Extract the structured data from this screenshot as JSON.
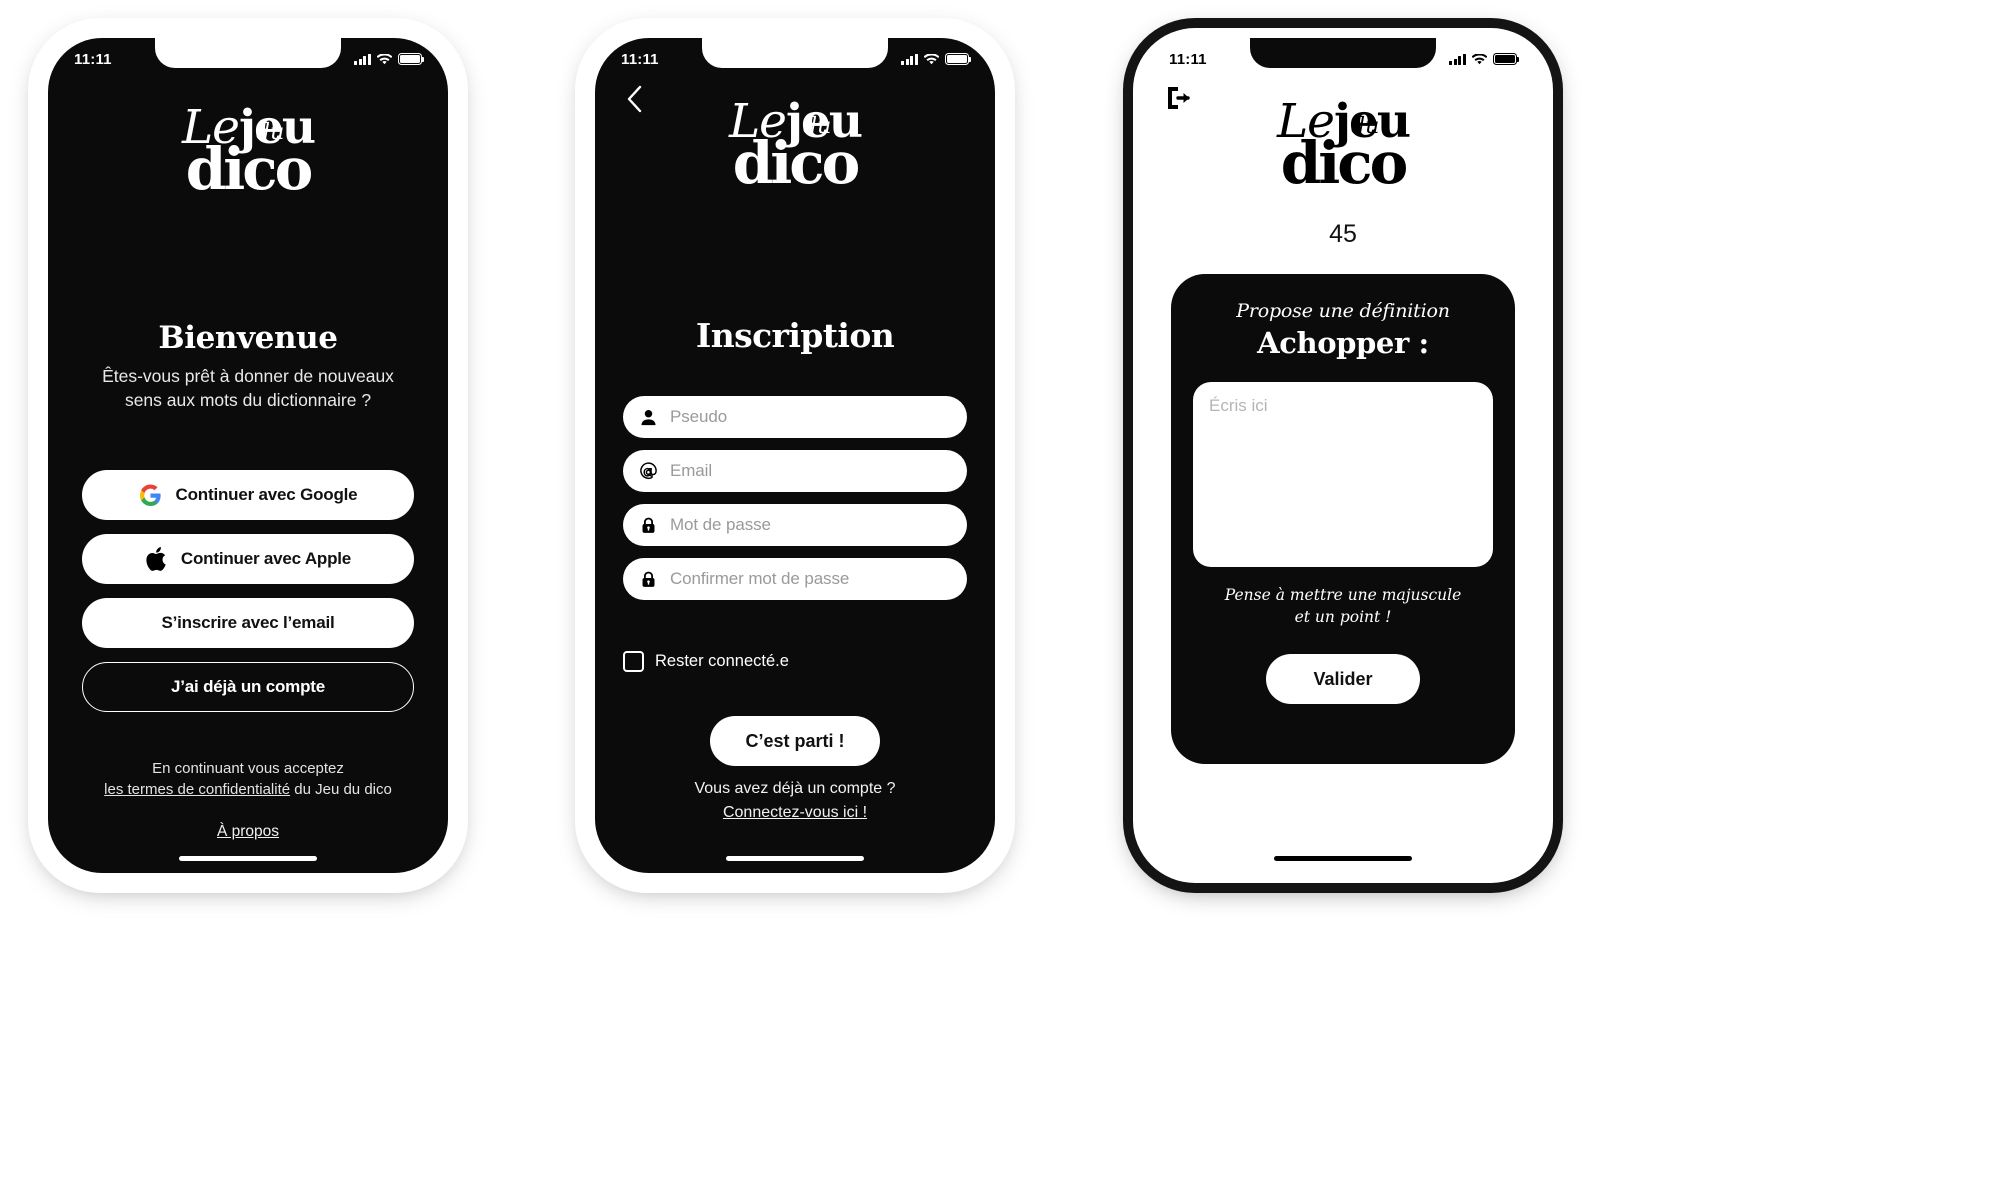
{
  "meta": {
    "accent_dark": "#0b0b0b",
    "accent_light": "#ffffff",
    "google_blue": "#4285F4",
    "google_red": "#EA4335",
    "google_yellow": "#FBBC05",
    "google_green": "#34A853"
  },
  "logo": {
    "word_le": "Le",
    "word_jeu": "jeu",
    "word_du": "du",
    "word_dico": "dico"
  },
  "status_bar": {
    "time": "11:11",
    "signal_icon": "signal-bars-icon",
    "wifi_icon": "wifi-icon",
    "battery_icon": "battery-icon"
  },
  "screen_welcome": {
    "title": "Bienvenue",
    "subtitle": "Êtes-vous prêt à donner de nouveaux sens aux mots du dictionnaire ?",
    "buttons": [
      {
        "label": "Continuer avec Google",
        "icon": "google-icon",
        "style": "filled"
      },
      {
        "label": "Continuer avec Apple",
        "icon": "apple-icon",
        "style": "filled"
      },
      {
        "label": "S’inscrire avec l’email",
        "icon": "",
        "style": "filled"
      },
      {
        "label": "J’ai déjà un compte",
        "icon": "",
        "style": "outline"
      }
    ],
    "footer_line1": "En continuant vous acceptez",
    "footer_link": "les termes de confidentialité",
    "footer_tail": " du Jeu du dico",
    "about_link": "À propos"
  },
  "screen_signup": {
    "back_icon": "chevron-left-icon",
    "title": "Inscription",
    "fields": [
      {
        "placeholder": "Pseudo",
        "icon": "person-icon"
      },
      {
        "placeholder": "Email",
        "icon": "at-icon"
      },
      {
        "placeholder": "Mot de passe",
        "icon": "lock-icon"
      },
      {
        "placeholder": "Confirmer mot de passe",
        "icon": "lock-icon"
      }
    ],
    "checkbox_label": "Rester connecté.e",
    "checkbox_checked": false,
    "submit_label": "C’est parti !",
    "footer_question": "Vous avez déjà un compte ?",
    "footer_link": "Connectez-vous ici !"
  },
  "screen_game": {
    "exit_icon": "exit-icon",
    "score": "45",
    "prompt": "Propose une définition",
    "word": "Achopper :",
    "input_placeholder": "Écris ici",
    "input_value": "",
    "hint_line1": "Pense à mettre une majuscule",
    "hint_line2": "et un point !",
    "submit_label": "Valider"
  }
}
